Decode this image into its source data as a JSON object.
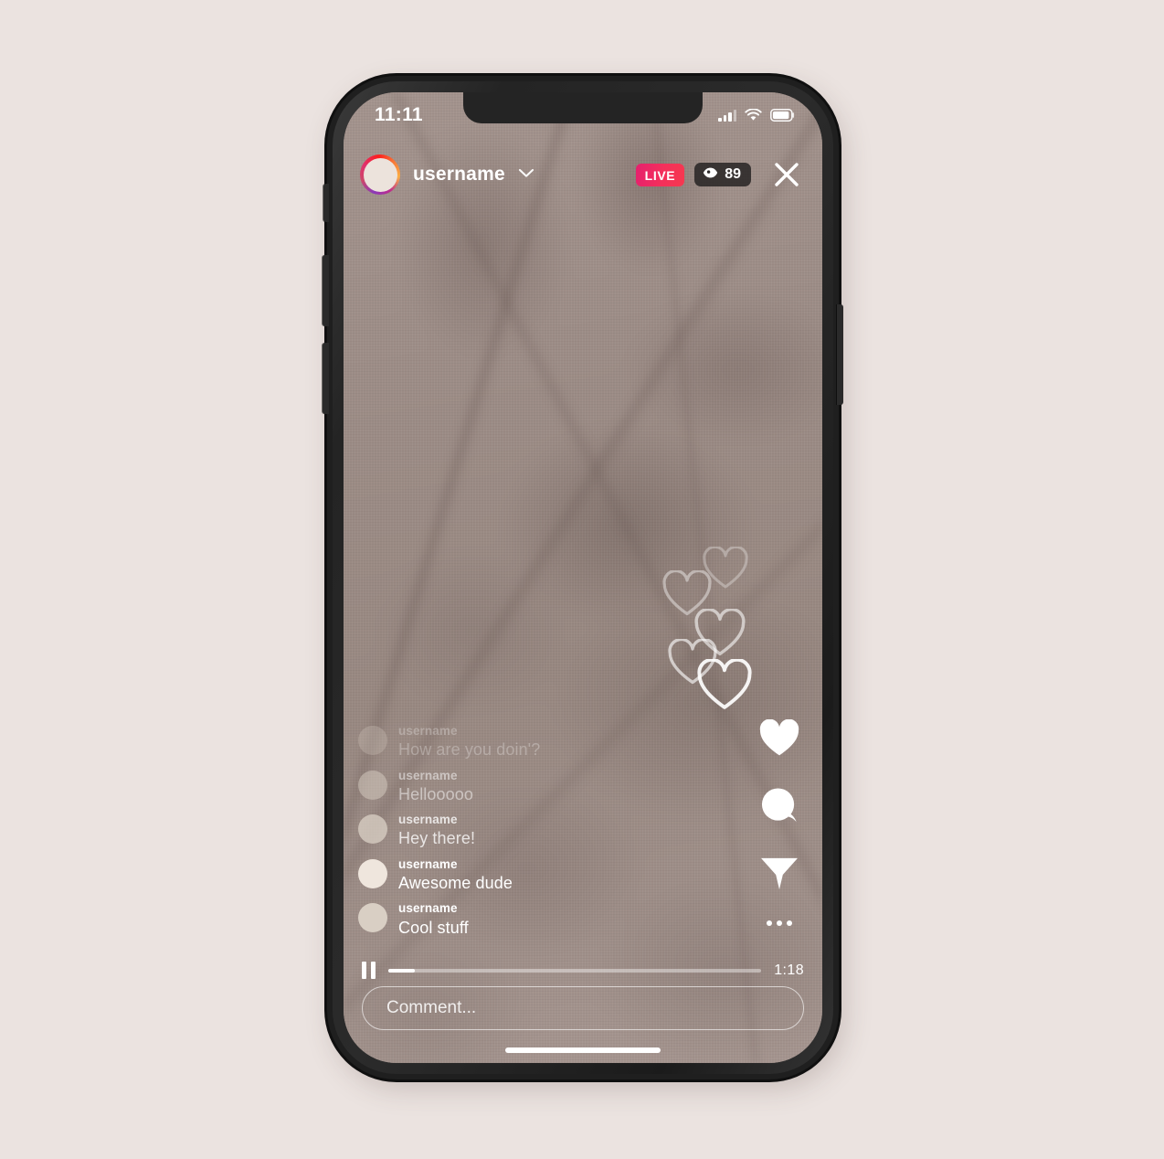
{
  "theme": {
    "page_background": "#EBE3E0",
    "frame_color": "#1F1F1F",
    "live_badge_gradient_start": "#E5206E",
    "live_badge_gradient_end": "#F6384F",
    "text_color": "#FFFFFF",
    "avatar_ring_gradient": "#8A3AB9 -> #E1306C -> #FCAF45"
  },
  "status_bar": {
    "time": "11:11",
    "signal_icon": "signal-bars-icon",
    "wifi_icon": "wifi-icon",
    "battery_icon": "battery-icon"
  },
  "header": {
    "avatar_name": "avatar",
    "username": "username",
    "chevron_icon": "chevron-down-icon",
    "live_label": "LIVE",
    "viewer_icon": "eye-icon",
    "viewer_count": "89",
    "close_icon": "close-icon"
  },
  "comments": [
    {
      "username": "username",
      "text": "How are you doin'?",
      "opacity": 0.28
    },
    {
      "username": "username",
      "text": "Hellooooo",
      "opacity": 0.5
    },
    {
      "username": "username",
      "text": "Hey there!",
      "opacity": 0.78
    },
    {
      "username": "username",
      "text": "Awesome dude",
      "opacity": 1.0
    },
    {
      "username": "username",
      "text": "Cool stuff",
      "opacity": 1.0
    }
  ],
  "actions": {
    "like_label": "Like",
    "like_icon": "heart-icon",
    "comment_label": "Comment",
    "comment_icon": "comment-bubble-icon",
    "share_label": "Share",
    "share_icon": "send-arrow-icon",
    "more_label": "More options",
    "more_icon": "more-dots-icon"
  },
  "floating_hearts": {
    "icon": "heart-outline-icon",
    "count": 5
  },
  "player": {
    "pause_icon": "pause-icon",
    "progress_percent": 7,
    "time_remaining": "1:18"
  },
  "comment_input": {
    "placeholder": "Comment...",
    "value": ""
  },
  "home_indicator": {
    "label": "home-indicator"
  }
}
